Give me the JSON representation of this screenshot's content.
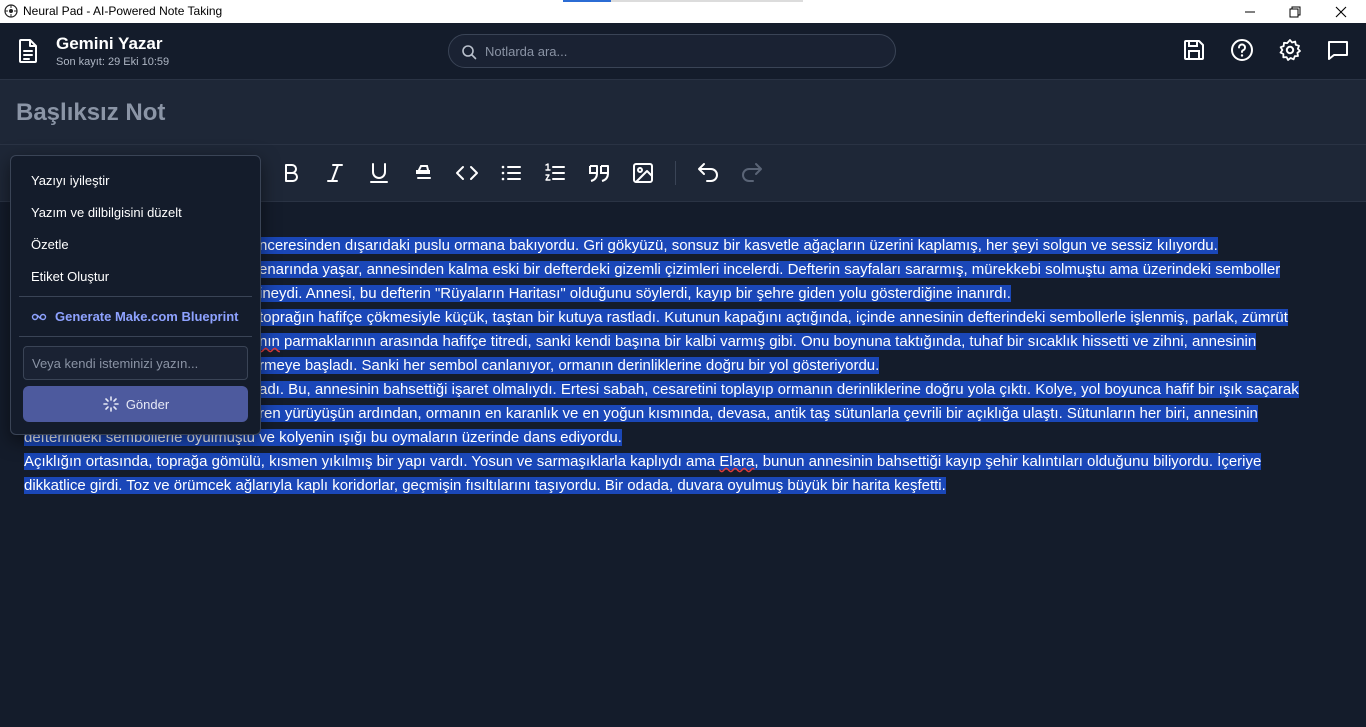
{
  "window": {
    "title": "Neural Pad - AI-Powered Note Taking"
  },
  "header": {
    "app_name": "Gemini Yazar",
    "last_saved": "Son kayıt: 29 Eki 10:59",
    "search_placeholder": "Notlarda ara..."
  },
  "note": {
    "title": "Başlıksız Not"
  },
  "toolbar": {
    "buttons": [
      "bold-icon",
      "italic-icon",
      "underline-icon",
      "highlight-icon",
      "code-icon",
      "bullet-list-icon",
      "numbered-list-icon",
      "quote-icon",
      "image-icon",
      "undo-icon",
      "redo-icon"
    ]
  },
  "ai_menu": {
    "improve": "Yazıyı iyileştir",
    "fix_grammar": "Yazım ve dilbilgisini düzelt",
    "summarize": "Özetle",
    "create_tags": "Etiket Oluştur",
    "blueprint": "Generate Make.com Blueprint",
    "input_placeholder": "Veya kendi isteminizi yazın...",
    "send": "Gönder"
  },
  "editor": {
    "l1": "nceresinden dışarıdaki puslu ormana bakıyordu. Gri gökyüzü, sonsuz bir kasvetle ağaçların üzerini kaplamış, her şeyi solgun ve sessiz kılıyordu.",
    "l2": "enarında yaşar, annesinden kalma eski bir defterdeki gizemli çizimleri incelerdi. Defterin sayfaları sararmış, mürekkebi solmuştu ama üzerindeki semboller",
    "l3": "ineydi. Annesi, bu defterin \"Rüyaların Haritası\" olduğunu söylerdi, kayıp bir şehre giden yolu gösterdiğine inanırdı.",
    "l4": "toprağın hafifçe çökmesiyle küçük, taştan bir kutuya rastladı. Kutunun kapağını açtığında, içinde annesinin defterindeki sembollerle işlenmiş, parlak, zümrüt",
    "l5a": "nın",
    "l5b": " parmaklarının arasında hafifçe titredi, sanki kendi başına bir kalbi varmış gibi. Onu boynuna taktığında, tuhaf bir sıcaklık hissetti ve zihni, annesinin",
    "l6": "rmeye başladı. Sanki her sembol canlanıyor, ormanın derinliklerine doğru bir yol gösteriyordu.",
    "l7": "adı. Bu, annesinin bahsettiği işaret olmalıydı. Ertesi sabah, cesaretini toplayıp ormanın derinliklerine doğru yola çıktı. Kolye, yol boyunca hafif bir ışık saçarak",
    "l8": "ren yürüyüşün ardından, ormanın en karanlık ve en yoğun kısmında, devasa, antik taş sütunlarla çevrili bir açıklığa ulaştı. Sütunların her biri, annesinin",
    "l9": "defterindeki sembollerle oyulmuştu ve kolyenin ışığı bu oymaların üzerinde dans ediyordu.",
    "l10a": "Açıklığın ortasında, toprağa gömülü, kısmen yıkılmış bir yapı vardı. Yosun ve sarmaşıklarla kaplıydı ama ",
    "l10name": "Elara",
    "l10b": ", bunun annesinin bahsettiği kayıp şehir kalıntıları olduğunu biliyordu. İçeriye",
    "l11": "dikkatlice girdi. Toz ve örümcek ağlarıyla kaplı koridorlar, geçmişin fısıltılarını taşıyordu. Bir odada, duvara oyulmuş büyük bir harita keşfetti."
  },
  "colors": {
    "background": "#141c2b",
    "panel": "#1e2737",
    "selection": "#1a47b8",
    "accent": "#8ea2ff",
    "send_button": "#4d5a9e"
  }
}
